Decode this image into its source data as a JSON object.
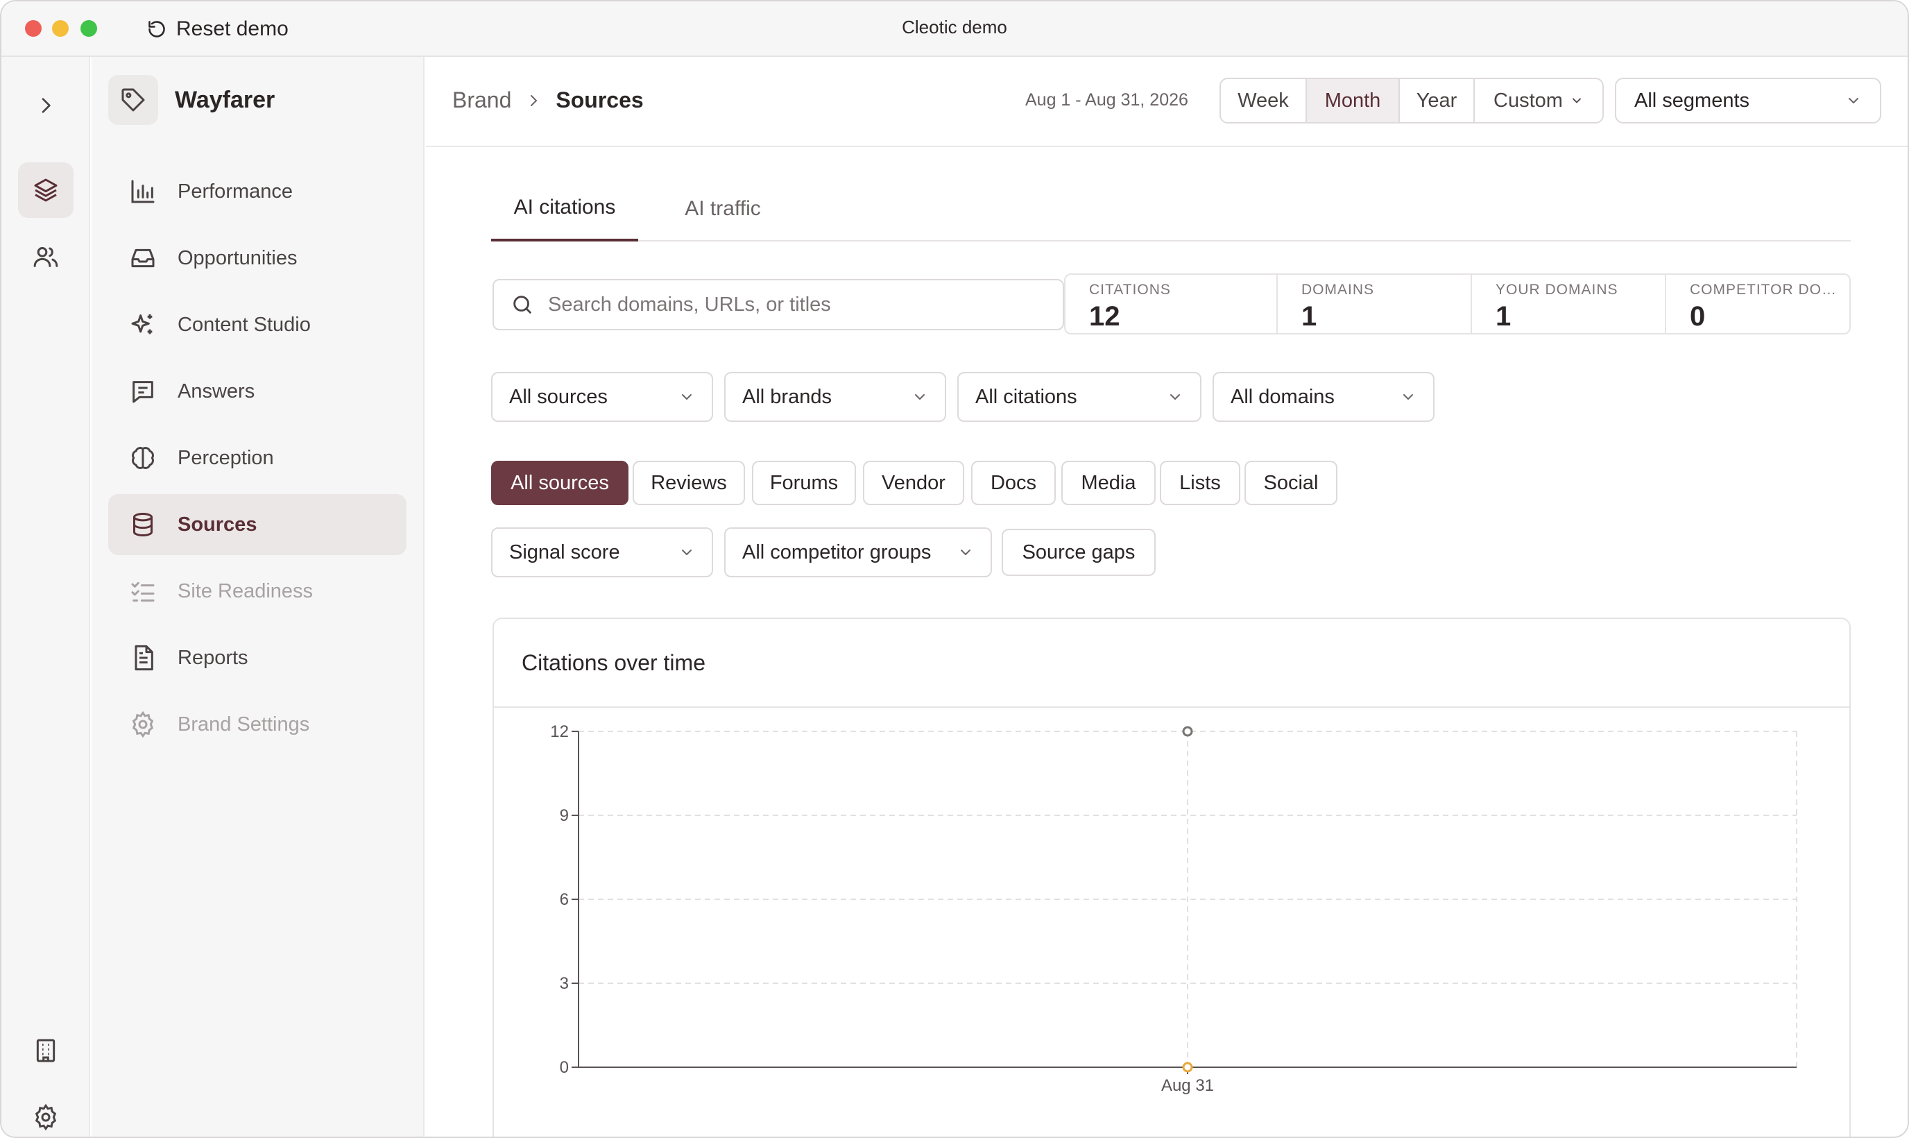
{
  "window": {
    "title": "Cleotic demo",
    "reset_label": "Reset demo"
  },
  "rail": {
    "items": [
      "layers-icon",
      "users-icon"
    ],
    "bottom": [
      "building-icon",
      "settings-icon"
    ]
  },
  "sidebar": {
    "brand_name": "Wayfarer",
    "items": [
      {
        "label": "Performance",
        "icon": "bar-chart-icon",
        "state": "normal"
      },
      {
        "label": "Opportunities",
        "icon": "inbox-icon",
        "state": "normal"
      },
      {
        "label": "Content Studio",
        "icon": "sparkles-icon",
        "state": "normal"
      },
      {
        "label": "Answers",
        "icon": "message-icon",
        "state": "normal"
      },
      {
        "label": "Perception",
        "icon": "brain-icon",
        "state": "normal"
      },
      {
        "label": "Sources",
        "icon": "database-icon",
        "state": "active"
      },
      {
        "label": "Site Readiness",
        "icon": "checklist-icon",
        "state": "disabled"
      },
      {
        "label": "Reports",
        "icon": "file-text-icon",
        "state": "normal"
      },
      {
        "label": "Brand Settings",
        "icon": "gear-icon",
        "state": "disabled"
      }
    ]
  },
  "header": {
    "breadcrumb_parent": "Brand",
    "breadcrumb_current": "Sources",
    "date_range": "Aug 1 - Aug 31, 2026",
    "periods": [
      "Week",
      "Month",
      "Year",
      "Custom"
    ],
    "active_period": "Month",
    "segments_label": "All segments"
  },
  "tabs": {
    "items": [
      "AI citations",
      "AI traffic"
    ],
    "active": "AI citations"
  },
  "search": {
    "placeholder": "Search domains, URLs, or titles"
  },
  "stats": [
    {
      "label": "CITATIONS",
      "value": "12"
    },
    {
      "label": "DOMAINS",
      "value": "1"
    },
    {
      "label": "YOUR DOMAINS",
      "value": "1"
    },
    {
      "label": "COMPETITOR DOMAINS",
      "value": "0"
    }
  ],
  "filters": [
    "All sources",
    "All brands",
    "All citations",
    "All domains"
  ],
  "source_types": {
    "items": [
      "All sources",
      "Reviews",
      "Forums",
      "Vendor",
      "Docs",
      "Media",
      "Lists",
      "Social"
    ],
    "active": "All sources"
  },
  "secondary_filters": {
    "signal_score": "Signal score",
    "competitor_groups": "All competitor groups",
    "source_gaps": "Source gaps"
  },
  "colors": {
    "accent": "#6b3a42",
    "series_primary": "#7a7374",
    "series_secondary": "#e8a93b"
  },
  "chart_data": {
    "type": "line",
    "title": "Citations over time",
    "categories": [
      "Aug 31"
    ],
    "series": [
      {
        "values": [
          12
        ]
      },
      {
        "values": [
          0
        ]
      }
    ],
    "yticks": [
      0,
      3,
      6,
      9,
      12
    ],
    "ylim": [
      0,
      12
    ],
    "grid": true
  }
}
